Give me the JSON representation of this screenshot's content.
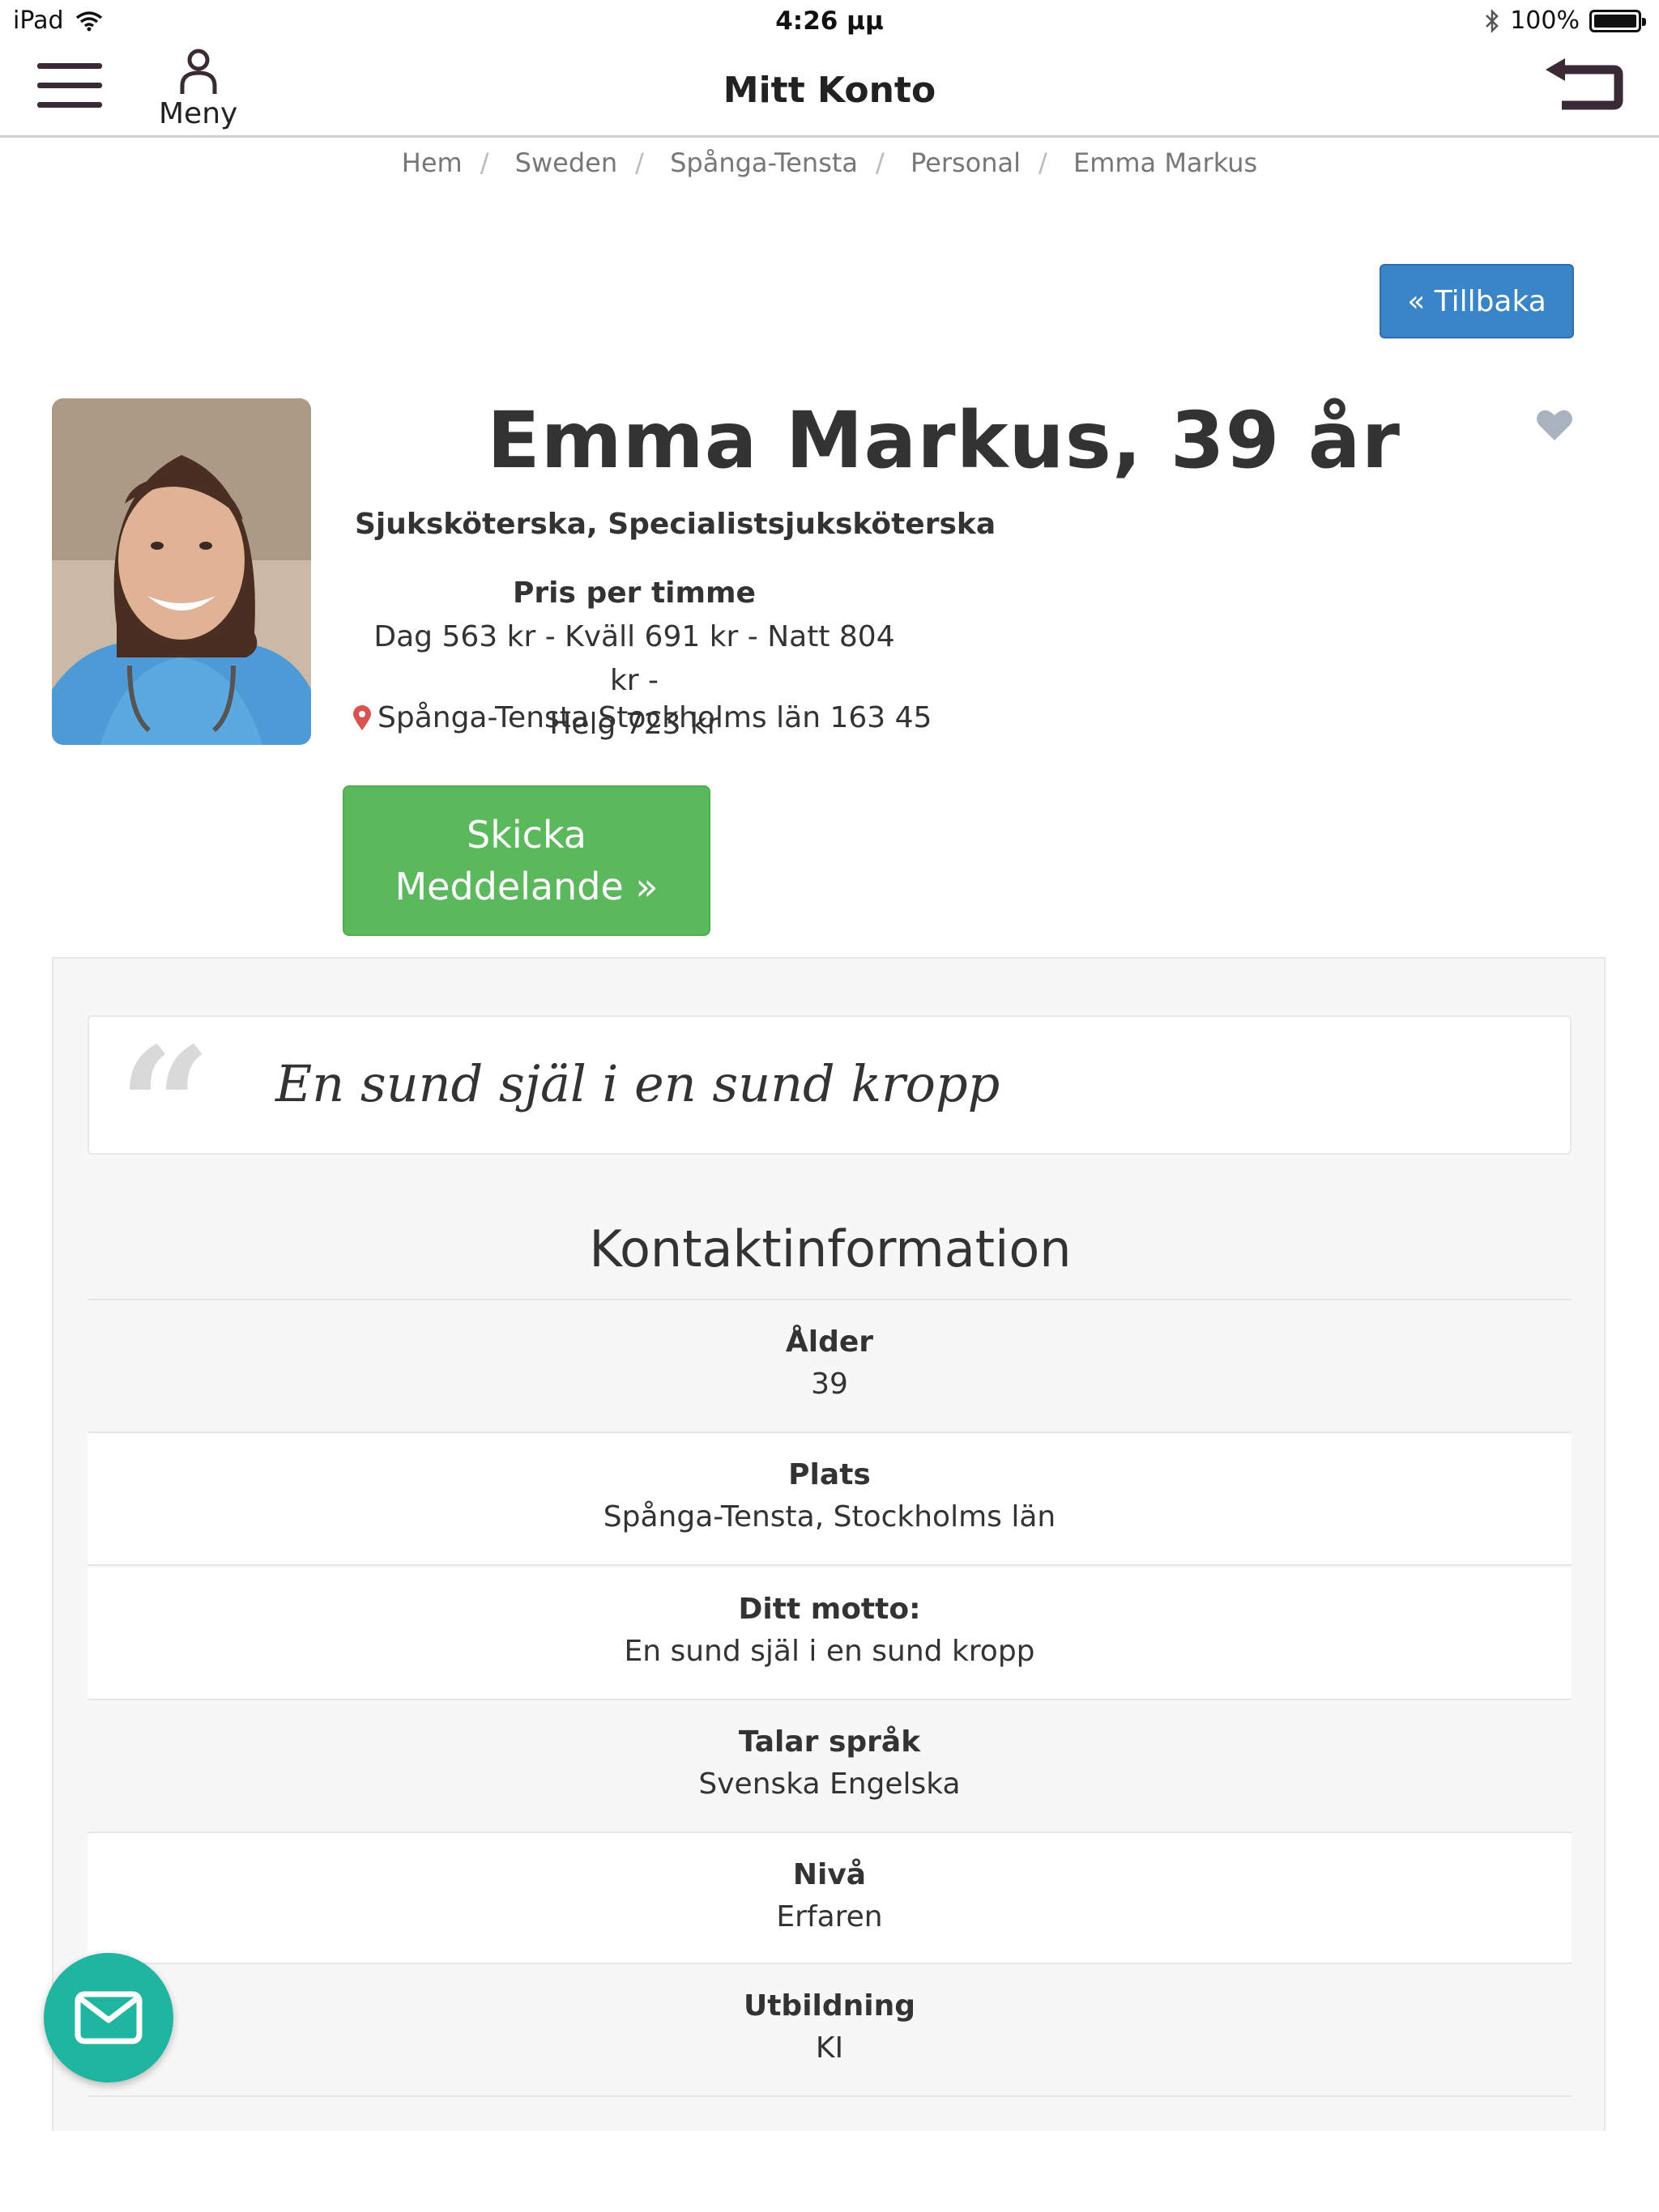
{
  "status_bar": {
    "device": "iPad",
    "time": "4:26 μμ",
    "battery": "100%"
  },
  "nav": {
    "menu_label": "Meny",
    "title": "Mitt Konto"
  },
  "breadcrumb": [
    "Hem",
    "Sweden",
    "Spånga-Tensta",
    "Personal",
    "Emma Markus"
  ],
  "back_button": "« Tillbaka",
  "profile": {
    "name": "Emma Markus, 39 år",
    "profession": "Sjuksköterska, Specialistsjuksköterska",
    "price_title": "Pris per timme",
    "price_line1": "Dag 563 kr - Kväll 691 kr - Natt 804 kr -",
    "price_line2": "Helg 723 kr",
    "location": "Spånga-Tensta Stockholms län 163 45"
  },
  "send_button": {
    "line1": "Skicka",
    "line2": "Meddelande »"
  },
  "motto_quote": "En sund själ i en sund kropp",
  "contact": {
    "title": "Kontaktinformation",
    "rows": [
      {
        "label": "Ålder",
        "value": "39"
      },
      {
        "label": "Plats",
        "value": "Spånga-Tensta, Stockholms län"
      },
      {
        "label": "Ditt motto:",
        "value": "En sund själ i en sund kropp"
      },
      {
        "label": "Talar språk",
        "value": "Svenska Engelska"
      },
      {
        "label": "Nivå",
        "value": "Erfaren"
      },
      {
        "label": "Utbildning",
        "value": "KI"
      }
    ]
  },
  "icons": {
    "menu": "hamburger-icon",
    "user": "user-icon",
    "back": "return-arrow-icon",
    "favorite": "heart-icon",
    "location": "map-pin-icon",
    "mail": "mail-icon"
  },
  "colors": {
    "primary_button": "#3a84c8",
    "send_button": "#5cb85c",
    "fab": "#1fb5a0",
    "nav_icon": "#3a2a36",
    "pin": "#d9534f"
  }
}
